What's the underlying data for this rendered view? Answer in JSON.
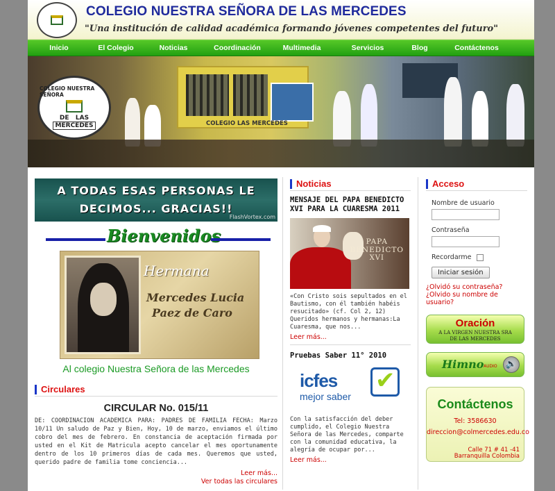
{
  "site": {
    "title": "COLEGIO NUESTRA SEÑORA DE LAS MERCEDES",
    "tagline": "\"Una institución de calidad académica formando jóvenes competentes del futuro\""
  },
  "nav": [
    "Inicio",
    "El Colegio",
    "Noticias",
    "Coordinación",
    "Multimedia",
    "Servicios",
    "Blog",
    "Contáctenos"
  ],
  "banner": {
    "seal_top": "COLEGIO NUESTRA SEÑORA",
    "seal_de": "DE",
    "seal_las": "LAS",
    "seal_mercedes": "MERCEDES",
    "wall_text": "COLEGIO LAS MERCEDES"
  },
  "left": {
    "flash_line1": "A TODAS ESAS PERSONAS LE",
    "flash_line2": "DECIMOS... GRACIAS!!",
    "flash_watermark": "FlashVortex.com",
    "bienvenidos": "Bienvenidos",
    "hermana_label": "Hermana",
    "hermana_name1": "Mercedes Lucia",
    "hermana_name2": "Paez de Caro",
    "caption": "Al colegio Nuestra Señora de las Mercedes"
  },
  "circulares": {
    "heading": "Circulares",
    "title": "CIRCULAR No. 015/11",
    "body": "DE:         COORDINACION ACADEMICA PARA:    PADRES DE FAMILIA FECHA:  Marzo 10/11 Un saludo de Paz y Bien, Hoy, 10 de marzo, enviamos el último cobro del mes de febrero. En constancia de aceptación firmada por usted en el Kit de Matricula acepto cancelar el mes oportunamente dentro de los 10 primeros días de cada mes. Queremos que usted, querido padre de familia tome conciencia...",
    "read_more": "Leer más...",
    "see_all": "Ver todas las circulares"
  },
  "noticias": {
    "heading": "Noticias",
    "items": [
      {
        "title": "MENSAJE DEL PAPA BENEDICTO XVI PARA LA CUARESMA 2011",
        "image_text_1": "PAPA",
        "image_text_2": "BENEDICTO",
        "image_text_3": "XVI",
        "text": "«Con Cristo sois sepultados en el Bautismo, con él también habéis resucitado» (cf. Col 2, 12) Queridos hermanos y hermanas:La Cuaresma, que nos...",
        "read_more": "Leer más..."
      },
      {
        "title": "Pruebas Saber 11° 2010",
        "logo_text_1": "icfes",
        "logo_text_2": "mejor saber",
        "text": "Con la satisfacción del deber cumplido, el Colegio Nuestra Señora de las Mercedes, comparte con la comunidad educativa, la alegría de ocupar por...",
        "read_more": "Leer más..."
      }
    ]
  },
  "acceso": {
    "heading": "Acceso",
    "username_label": "Nombre de usuario",
    "password_label": "Contraseña",
    "remember_label": "Recordarme",
    "login_button": "Iniciar sesión",
    "forgot_password": "¿Olvidó su contraseña?",
    "forgot_username": "¿Olvido su nombre de usuario?"
  },
  "widgets": {
    "oracion_title": "Oración",
    "oracion_sub_1": "A LA VIRGEN NUESTRA SRA",
    "oracion_sub_2": "DE LAS MERCEDES",
    "himno_title": "Himno",
    "himno_sub": "AUDIO",
    "contact_title": "Contáctenos",
    "contact_phone": "Tel: 3586630",
    "contact_email": "direccion@colmercedes.edu.co",
    "contact_address_1": "Calle 71 # 41 -41",
    "contact_address_2": "Barranquilla Colombia"
  },
  "colors": {
    "title_blue": "#1f2a9c",
    "nav_green": "#22a012",
    "heading_red": "#dd1111",
    "caption_green": "#1a9a24"
  }
}
